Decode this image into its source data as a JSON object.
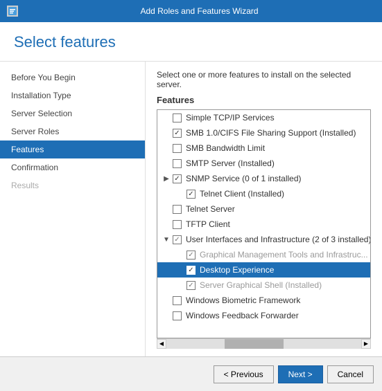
{
  "titleBar": {
    "icon": "wizard-icon",
    "title": "Add Roles and Features Wizard"
  },
  "pageTitle": "Select features",
  "description": "Select one or more features to install on the selected server.",
  "featuresLabel": "Features",
  "sidebar": {
    "items": [
      {
        "id": "before-you-begin",
        "label": "Before You Begin",
        "state": "normal"
      },
      {
        "id": "installation-type",
        "label": "Installation Type",
        "state": "normal"
      },
      {
        "id": "server-selection",
        "label": "Server Selection",
        "state": "normal"
      },
      {
        "id": "server-roles",
        "label": "Server Roles",
        "state": "normal"
      },
      {
        "id": "features",
        "label": "Features",
        "state": "active"
      },
      {
        "id": "confirmation",
        "label": "Confirmation",
        "state": "normal"
      },
      {
        "id": "results",
        "label": "Results",
        "state": "disabled"
      }
    ]
  },
  "features": [
    {
      "id": "simple-tcp",
      "label": "Simple TCP/IP Services",
      "indent": 1,
      "checked": false,
      "hasExpand": false
    },
    {
      "id": "smb10",
      "label": "SMB 1.0/CIFS File Sharing Support (Installed)",
      "indent": 1,
      "checked": true,
      "hasExpand": false
    },
    {
      "id": "smb-bandwidth",
      "label": "SMB Bandwidth Limit",
      "indent": 1,
      "checked": false,
      "hasExpand": false
    },
    {
      "id": "smtp-server",
      "label": "SMTP Server (Installed)",
      "indent": 1,
      "checked": false,
      "hasExpand": false
    },
    {
      "id": "snmp-service",
      "label": "SNMP Service (0 of 1 installed)",
      "indent": 1,
      "checked": true,
      "hasExpand": true,
      "expandDir": "right"
    },
    {
      "id": "telnet-client",
      "label": "Telnet Client (Installed)",
      "indent": 2,
      "checked": true,
      "hasExpand": false
    },
    {
      "id": "telnet-server",
      "label": "Telnet Server",
      "indent": 1,
      "checked": false,
      "hasExpand": false
    },
    {
      "id": "tftp-client",
      "label": "TFTP Client",
      "indent": 1,
      "checked": false,
      "hasExpand": false
    },
    {
      "id": "user-interfaces",
      "label": "User Interfaces and Infrastructure (2 of 3 installed)",
      "indent": 1,
      "checked": true,
      "hasExpand": true,
      "expandDir": "down",
      "partial": true
    },
    {
      "id": "graphical-mgmt",
      "label": "Graphical Management Tools and Infrastruc...",
      "indent": 2,
      "checked": true,
      "hasExpand": false,
      "grayed": true
    },
    {
      "id": "desktop-experience",
      "label": "Desktop Experience",
      "indent": 2,
      "checked": true,
      "hasExpand": false,
      "selected": true
    },
    {
      "id": "server-graphical",
      "label": "Server Graphical Shell (Installed)",
      "indent": 2,
      "checked": true,
      "hasExpand": false,
      "grayed": true
    },
    {
      "id": "windows-biometric",
      "label": "Windows Biometric Framework",
      "indent": 1,
      "checked": false,
      "hasExpand": false
    },
    {
      "id": "windows-feedback",
      "label": "Windows Feedback Forwarder",
      "indent": 1,
      "checked": false,
      "hasExpand": false
    }
  ],
  "footer": {
    "previousLabel": "< Previous",
    "nextLabel": "Next >",
    "cancelLabel": "Cancel"
  }
}
